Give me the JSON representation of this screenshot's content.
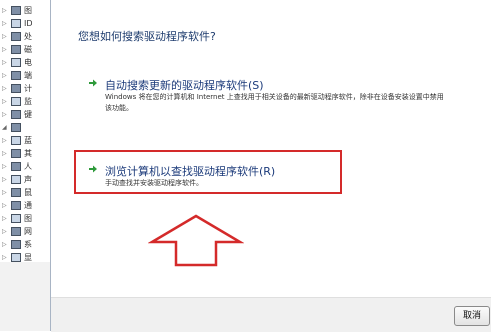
{
  "tree": {
    "rows": [
      {
        "expander": "▷",
        "label": "图",
        "icon": "drive-icon"
      },
      {
        "expander": "▷",
        "label": "ID",
        "icon": "controller-icon"
      },
      {
        "expander": "▷",
        "label": "处",
        "icon": "processor-icon"
      },
      {
        "expander": "▷",
        "label": "磁",
        "icon": "disk-icon"
      },
      {
        "expander": "▷",
        "label": "电",
        "icon": "battery-icon"
      },
      {
        "expander": "▷",
        "label": "端",
        "icon": "port-icon"
      },
      {
        "expander": "▷",
        "label": "计",
        "icon": "computer-icon"
      },
      {
        "expander": "▷",
        "label": "监",
        "icon": "monitor-icon"
      },
      {
        "expander": "▷",
        "label": "键",
        "icon": "keyboard-icon"
      },
      {
        "expander": "◢",
        "label": "",
        "icon": "device-icon"
      },
      {
        "expander": "▷",
        "label": "蓝",
        "icon": "bluetooth-icon"
      },
      {
        "expander": "▷",
        "label": "其",
        "icon": "device-icon"
      },
      {
        "expander": "▷",
        "label": "人",
        "icon": "hid-icon"
      },
      {
        "expander": "▷",
        "label": "声",
        "icon": "sound-icon"
      },
      {
        "expander": "▷",
        "label": "鼠",
        "icon": "mouse-icon"
      },
      {
        "expander": "▷",
        "label": "通",
        "icon": "usb-icon"
      },
      {
        "expander": "▷",
        "label": "图",
        "icon": "imaging-icon"
      },
      {
        "expander": "▷",
        "label": "网",
        "icon": "network-icon"
      },
      {
        "expander": "▷",
        "label": "系",
        "icon": "system-icon"
      },
      {
        "expander": "▷",
        "label": "显",
        "icon": "display-icon"
      }
    ]
  },
  "dialog": {
    "heading": "您想如何搜索驱动程序软件?",
    "option_auto": {
      "title": "自动搜索更新的驱动程序软件(S)",
      "description": "Windows 将在您的计算机和 Internet 上查找用于相关设备的最新驱动程序软件，除非在设备安装设置中禁用该功能。"
    },
    "option_browse": {
      "title": "浏览计算机以查找驱动程序软件(R)",
      "description": "手动查找并安装驱动程序软件。"
    },
    "cancel_label": "取消"
  },
  "colors": {
    "highlight": "#d42a2a",
    "option_arrow": "#2e9a3a",
    "link_text": "#1b3a7a"
  }
}
